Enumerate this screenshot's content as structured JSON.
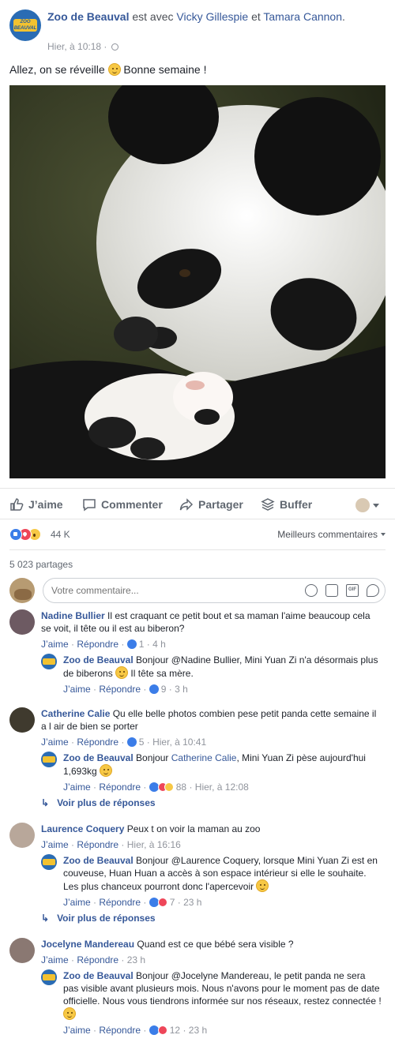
{
  "post": {
    "page_name": "Zoo de Beauval",
    "with_text": "est avec",
    "tag1": "Vicky Gillespie",
    "and_text": "et",
    "tag2": "Tamara Cannon",
    "period": ".",
    "timestamp": "Hier, à 10:18 ·",
    "text_before": "Allez, on se réveille",
    "text_after": "Bonne semaine !",
    "logo_text": "ZOO PARC DE BEAUVAL"
  },
  "actions": {
    "like": "J’aime",
    "comment": "Commenter",
    "share": "Partager",
    "buffer": "Buffer"
  },
  "stats": {
    "reaction_count": "44 K",
    "best_comments": "Meilleurs commentaires",
    "shares": "5 023 partages"
  },
  "composer": {
    "placeholder": "Votre commentaire...",
    "gif": "GIF"
  },
  "comments": [
    {
      "name": "Nadine Bullier",
      "text": "Il est craquant ce petit bout et sa maman l'aime beaucoup cela se voit, il tête ou il est au biberon?",
      "like": "J’aime",
      "reply": "Répondre",
      "meta": " · ",
      "count": "1",
      "time": " · 4 h",
      "replies": [
        {
          "name": "Zoo de Beauval",
          "text": "Bonjour @Nadine Bullier, Mini Yuan Zi n'a désormais plus de biberons",
          "text2": "Il tête sa mère.",
          "like": "J’aime",
          "reply": "Répondre",
          "count": "9",
          "time": " · 3 h"
        }
      ]
    },
    {
      "name": "Catherine Calie",
      "text": "Qu elle belle photos combien pese petit panda cette semaine il a l air de bien se porter",
      "like": "J’aime",
      "reply": "Répondre",
      "count": "5",
      "time": " · Hier, à 10:41",
      "replies": [
        {
          "name": "Zoo de Beauval",
          "text_pre": "Bonjour",
          "mention": "Catherine Calie",
          "text": ", Mini Yuan Zi pèse aujourd'hui 1,693kg",
          "like": "J’aime",
          "reply": "Répondre",
          "count": "88",
          "time": " · Hier, à 12:08"
        }
      ],
      "more": "Voir plus de réponses"
    },
    {
      "name": "Laurence Coquery",
      "text": "Peux t on voir la maman au zoo",
      "like": "J’aime",
      "reply": "Répondre",
      "time": " · Hier, à 16:16",
      "replies": [
        {
          "name": "Zoo de Beauval",
          "text": "Bonjour @Laurence Coquery, lorsque Mini Yuan Zi est en couveuse, Huan Huan a accès à son espace intérieur si elle le souhaite. Les plus chanceux pourront donc l'apercevoir",
          "like": "J’aime",
          "reply": "Répondre",
          "count": "7",
          "time": " · 23 h"
        }
      ],
      "more": "Voir plus de réponses"
    },
    {
      "name": "Jocelyne Mandereau",
      "text": "Quand est ce que bébé sera visible ?",
      "like": "J’aime",
      "reply": "Répondre",
      "time": " · 23 h",
      "replies": [
        {
          "name": "Zoo de Beauval",
          "text": "Bonjour @Jocelyne Mandereau, le petit panda ne sera pas visible avant plusieurs mois. Nous n'avons pour le moment pas de date officielle. Nous vous tiendrons informée sur nos réseaux, restez connectée !",
          "like": "J’aime",
          "reply": "Répondre",
          "count": "12",
          "time": " · 23 h"
        }
      ]
    }
  ],
  "colors": {
    "link": "#365899",
    "meta": "#90949c",
    "like_blue": "#3b7de8",
    "love_red": "#ee4659"
  }
}
